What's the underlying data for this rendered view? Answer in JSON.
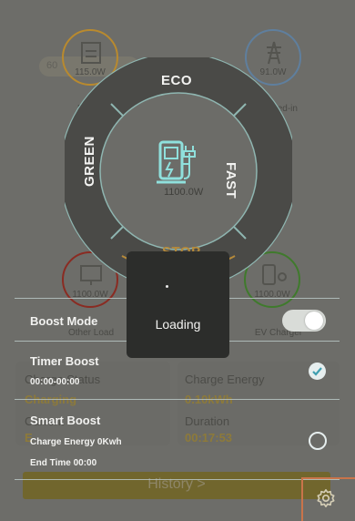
{
  "energy_nodes": {
    "solar": {
      "value": "115.0W",
      "label": "Feed-in"
    },
    "grid": {
      "value": "91.0W",
      "label": "Feed-in"
    },
    "other_load": {
      "value": "1100.0W",
      "label": "Other Load"
    },
    "ev_charger": {
      "value": "1100.0W",
      "label": "EV Charger"
    },
    "center": {
      "value": "1100.0W"
    },
    "pill_text": "60"
  },
  "modes": {
    "eco": "ECO",
    "fast": "FAST",
    "stop": "STOP",
    "green": "GREEN"
  },
  "cards": {
    "charge_status_label": "Charge Status",
    "charge_status_value": "Charging",
    "charge_energy_label": "Charge Energy",
    "charge_energy_value": "0.10kWh",
    "current_label": "Current",
    "current_value": "E",
    "duration_label": "Duration",
    "duration_value": "00:17:53"
  },
  "history_button": "History  >",
  "overlay": {
    "boost_mode": "Boost Mode",
    "timer_boost": "Timer Boost",
    "timer_time": "00:00-00:00",
    "smart_boost": "Smart Boost",
    "charge_energy": "Charge Energy 0Kwh",
    "end_time": "End Time 00:00",
    "boost_on": true
  },
  "loading_dialog": {
    "text": "Loading"
  },
  "colors": {
    "accent_orange": "#c9744a",
    "solar_ring": "#b98a2e",
    "grid_ring": "#5f7f9e",
    "load_ring": "#8a2b22",
    "ev_ring": "#3f7a2c"
  }
}
